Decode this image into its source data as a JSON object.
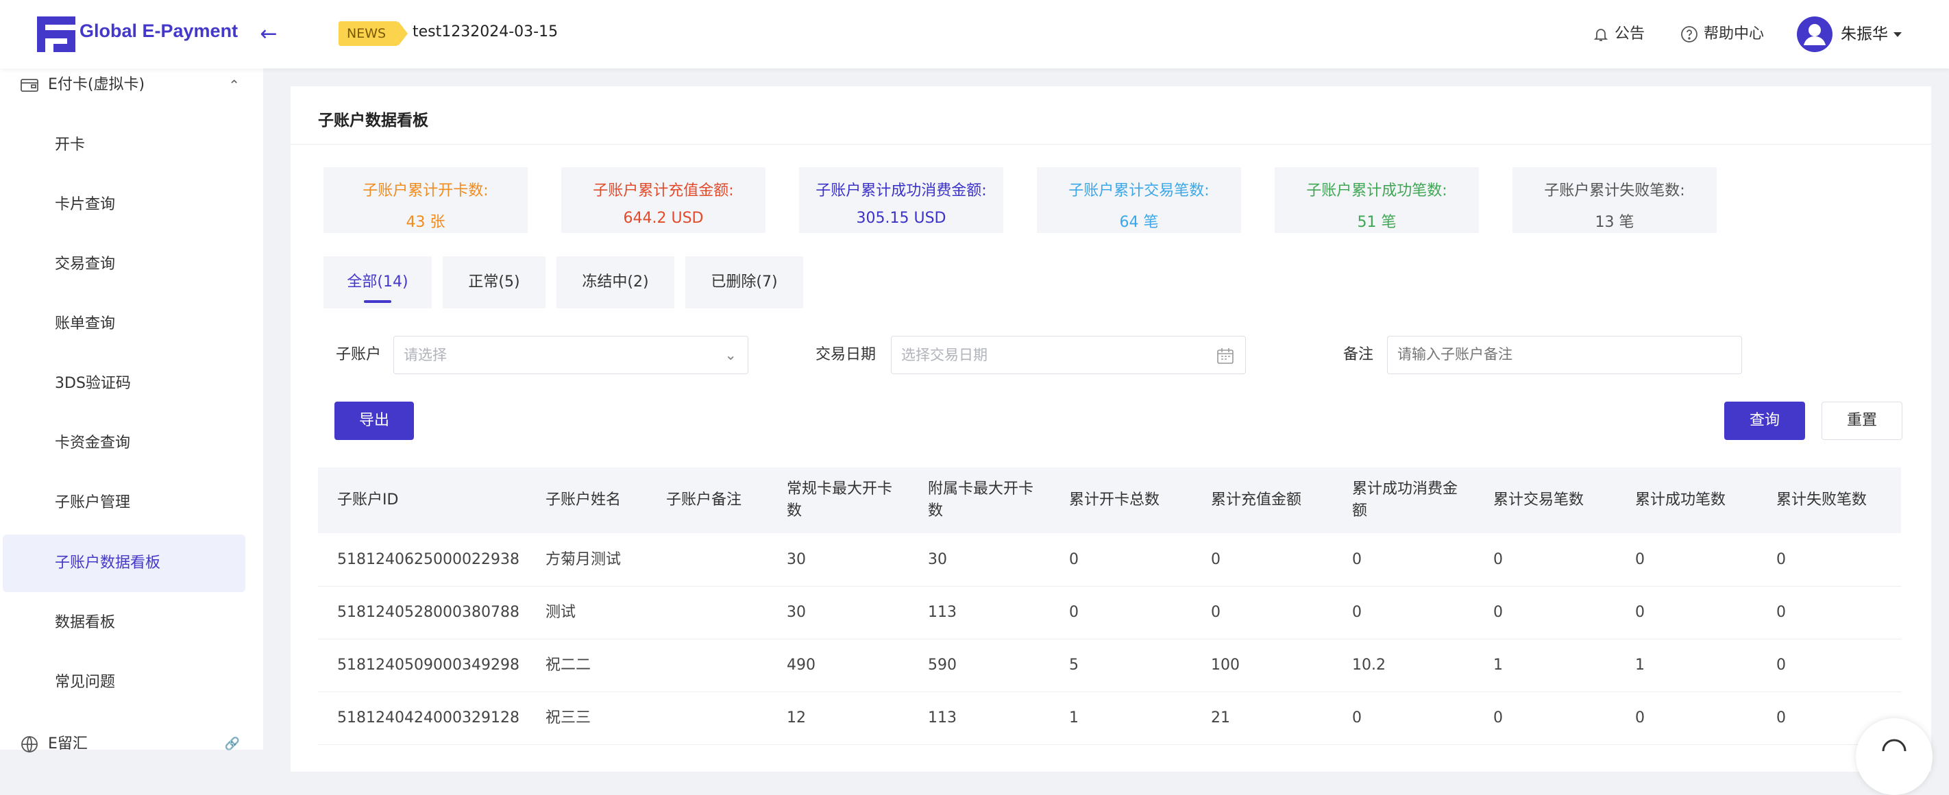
{
  "header": {
    "logo_text": "Global E-Payment",
    "news_badge": "NEWS",
    "news_text": "test1232024-03-15",
    "notice_label": "公告",
    "help_label": "帮助中心",
    "username": "朱振华"
  },
  "sidebar": {
    "group_label": "E付卡(虚拟卡)",
    "items": [
      {
        "label": "开卡"
      },
      {
        "label": "卡片查询"
      },
      {
        "label": "交易查询"
      },
      {
        "label": "账单查询"
      },
      {
        "label": "3DS验证码"
      },
      {
        "label": "卡资金查询"
      },
      {
        "label": "子账户管理"
      },
      {
        "label": "子账户数据看板",
        "active": true
      },
      {
        "label": "数据看板"
      },
      {
        "label": "常见问题"
      }
    ],
    "group2_label": "E留汇"
  },
  "panel": {
    "title": "子账户数据看板"
  },
  "stats": [
    {
      "label": "子账户累计开卡数:",
      "value": "43 张",
      "color": "#f08c1d"
    },
    {
      "label": "子账户累计充值金额:",
      "value": "644.2 USD",
      "color": "#e14b2b"
    },
    {
      "label": "子账户累计成功消费金额:",
      "value": "305.15 USD",
      "color": "#3b32c9"
    },
    {
      "label": "子账户累计交易笔数:",
      "value": "64 笔",
      "color": "#3ba7e8"
    },
    {
      "label": "子账户累计成功笔数:",
      "value": "51 笔",
      "color": "#3fa653"
    },
    {
      "label": "子账户累计失败笔数:",
      "value": "13 笔",
      "color": "#555555"
    }
  ],
  "tabs": [
    {
      "label": "全部(14)",
      "active": true
    },
    {
      "label": "正常(5)"
    },
    {
      "label": "冻结中(2)"
    },
    {
      "label": "已删除(7)"
    }
  ],
  "filters": {
    "subaccount_label": "子账户",
    "subaccount_placeholder": "请选择",
    "date_label": "交易日期",
    "date_placeholder": "选择交易日期",
    "remark_label": "备注",
    "remark_placeholder": "请输入子账户备注"
  },
  "buttons": {
    "export": "导出",
    "query": "查询",
    "reset": "重置"
  },
  "table": {
    "columns": [
      "子账户ID",
      "子账户姓名",
      "子账户备注",
      "常规卡最大开卡数",
      "附属卡最大开卡数",
      "累计开卡总数",
      "累计充值金额",
      "累计成功消费金额",
      "累计交易笔数",
      "累计成功笔数",
      "累计失败笔数"
    ],
    "rows": [
      [
        "5181240625000022938",
        "方菊月测试",
        "",
        "30",
        "30",
        "0",
        "0",
        "0",
        "0",
        "0",
        "0"
      ],
      [
        "5181240528000380788",
        "测试",
        "",
        "30",
        "113",
        "0",
        "0",
        "0",
        "0",
        "0",
        "0"
      ],
      [
        "5181240509000349298",
        "祝二二",
        "",
        "490",
        "590",
        "5",
        "100",
        "10.2",
        "1",
        "1",
        "0"
      ],
      [
        "5181240424000329128",
        "祝三三",
        "",
        "12",
        "113",
        "1",
        "21",
        "0",
        "0",
        "0",
        "0"
      ]
    ]
  },
  "colors": {
    "accent": "#4338ca",
    "active_bg": "#eef0fb",
    "news_badge": "#fcd34d"
  }
}
